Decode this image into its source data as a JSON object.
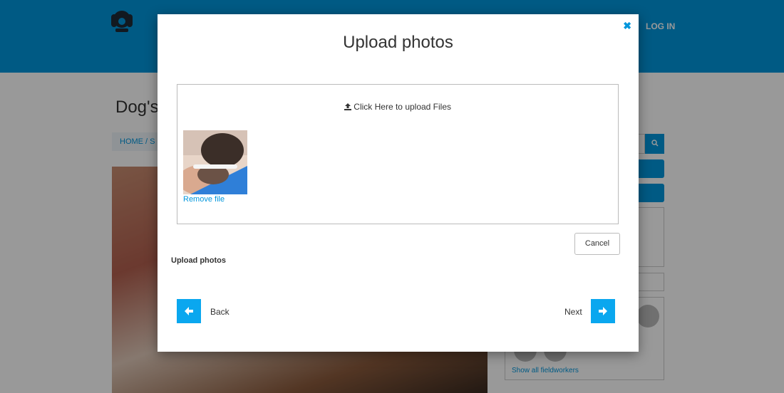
{
  "header": {
    "login_label": "LOG IN"
  },
  "page": {
    "title": "Dog's",
    "breadcrumb": "HOME  /  S"
  },
  "sidebar": {
    "fieldworkers_link": "Show all fieldworkers"
  },
  "modal": {
    "title": "Upload photos",
    "close_icon": "close-icon",
    "upload_label": "Click Here to upload Files",
    "remove_label": "Remove file",
    "cancel_label": "Cancel",
    "section_label": "Upload photos",
    "back_label": "Back",
    "next_label": "Next"
  },
  "colors": {
    "brand": "#0096dc",
    "nav_button": "#0aa7ef"
  }
}
